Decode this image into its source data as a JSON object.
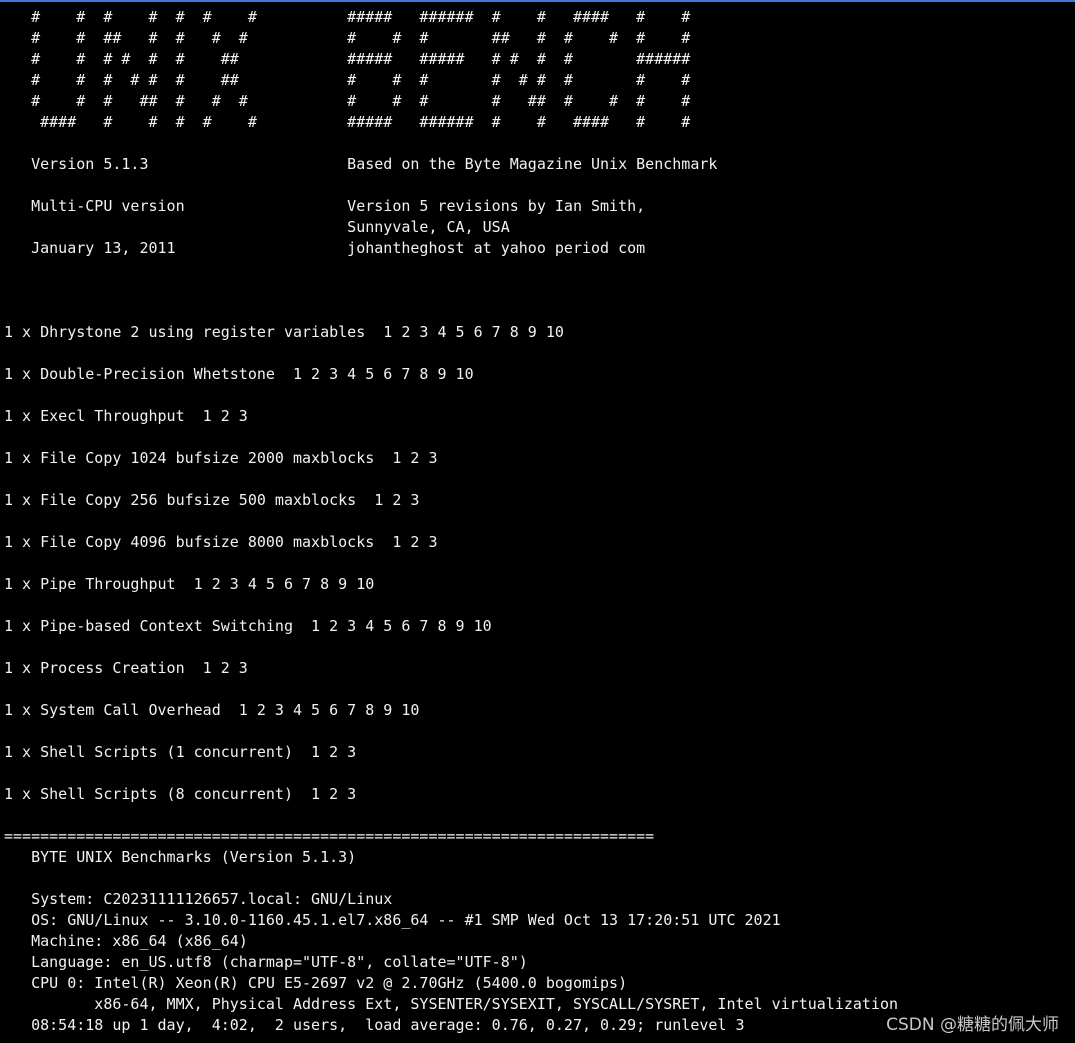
{
  "colors": {
    "background": "#000000",
    "text": "#f2f2f2",
    "top_accent": "#3a7bd5",
    "watermark": "#c8c8c8"
  },
  "terminal": {
    "lines": [
      "   #    #  #    #  #  #    #          #####   ######  #    #   ####   #    #",
      "   #    #  ##   #  #   #  #           #    #  #       ##   #  #    #  #    #",
      "   #    #  # #  #  #    ##            #####   #####   # #  #  #       ######",
      "   #    #  #  # #  #    ##            #    #  #       #  # #  #       #    #",
      "   #    #  #   ##  #   #  #           #    #  #       #   ##  #    #  #    #",
      "    ####   #    #  #  #    #          #####   ######  #    #   ####   #    #",
      "",
      "   Version 5.1.3                      Based on the Byte Magazine Unix Benchmark",
      "",
      "   Multi-CPU version                  Version 5 revisions by Ian Smith,",
      "                                      Sunnyvale, CA, USA",
      "   January 13, 2011                   johantheghost at yahoo period com",
      "",
      "",
      "",
      "1 x Dhrystone 2 using register variables  1 2 3 4 5 6 7 8 9 10",
      "",
      "1 x Double-Precision Whetstone  1 2 3 4 5 6 7 8 9 10",
      "",
      "1 x Execl Throughput  1 2 3",
      "",
      "1 x File Copy 1024 bufsize 2000 maxblocks  1 2 3",
      "",
      "1 x File Copy 256 bufsize 500 maxblocks  1 2 3",
      "",
      "1 x File Copy 4096 bufsize 8000 maxblocks  1 2 3",
      "",
      "1 x Pipe Throughput  1 2 3 4 5 6 7 8 9 10",
      "",
      "1 x Pipe-based Context Switching  1 2 3 4 5 6 7 8 9 10",
      "",
      "1 x Process Creation  1 2 3",
      "",
      "1 x System Call Overhead  1 2 3 4 5 6 7 8 9 10",
      "",
      "1 x Shell Scripts (1 concurrent)  1 2 3",
      "",
      "1 x Shell Scripts (8 concurrent)  1 2 3",
      "",
      "========================================================================",
      "   BYTE UNIX Benchmarks (Version 5.1.3)",
      "",
      "   System: C20231111126657.local: GNU/Linux",
      "   OS: GNU/Linux -- 3.10.0-1160.45.1.el7.x86_64 -- #1 SMP Wed Oct 13 17:20:51 UTC 2021",
      "   Machine: x86_64 (x86_64)",
      "   Language: en_US.utf8 (charmap=\"UTF-8\", collate=\"UTF-8\")",
      "   CPU 0: Intel(R) Xeon(R) CPU E5-2697 v2 @ 2.70GHz (5400.0 bogomips)",
      "          x86-64, MMX, Physical Address Ext, SYSENTER/SYSEXIT, SYSCALL/SYSRET, Intel virtualization",
      "   08:54:18 up 1 day,  4:02,  2 users,  load average: 0.76, 0.27, 0.29; runlevel 3"
    ]
  },
  "watermark": {
    "text": "CSDN @糖糖的佩大师"
  }
}
